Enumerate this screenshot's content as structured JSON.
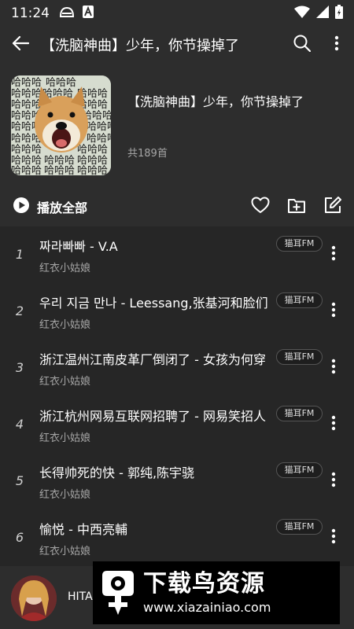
{
  "status_bar": {
    "time": "11:24",
    "left_icons": [
      "cat-ears-icon",
      "font-a-icon"
    ],
    "right_icons": [
      "wifi-icon",
      "signal-icon",
      "battery-icon"
    ]
  },
  "top_bar": {
    "title": "【洗脑神曲】少年，你节操掉了",
    "icons": [
      "back-arrow-icon",
      "search-icon",
      "more-vertical-icon"
    ]
  },
  "playlist": {
    "title": "【洗脑神曲】少年，你节操掉了",
    "count_text": "共189首",
    "cover_text": "哈哈哈"
  },
  "actions": {
    "play_all_label": "播放全部",
    "icons": [
      "play-circle-icon",
      "heart-icon",
      "add-folder-icon",
      "edit-icon"
    ]
  },
  "songs": [
    {
      "index": "1",
      "title": "짜라빠빠 - V.A",
      "artist": "红衣小姑娘",
      "badge": "猫耳FM"
    },
    {
      "index": "2",
      "title": "우리 지금 만나 - Leessang,张基河和脸们",
      "artist": "红衣小姑娘",
      "badge": "猫耳FM"
    },
    {
      "index": "3",
      "title": "浙江温州江南皮革厂倒闭了 - 女孩为何穿",
      "artist": "红衣小姑娘",
      "badge": "猫耳FM"
    },
    {
      "index": "4",
      "title": "浙江杭州网易互联网招聘了 - 网易笑招人",
      "artist": "红衣小姑娘",
      "badge": "猫耳FM"
    },
    {
      "index": "5",
      "title": "长得帅死的快 - 郭纯,陈宇骁",
      "artist": "红衣小姑娘",
      "badge": "猫耳FM"
    },
    {
      "index": "6",
      "title": "愉悦 - 中西亮輔",
      "artist": "红衣小姑娘",
      "badge": "猫耳FM"
    }
  ],
  "player": {
    "title": "HITA"
  },
  "watermark": {
    "title": "下载鸟资源",
    "url": "www.xiazainiao.com"
  },
  "colors": {
    "background": "#262626",
    "surface": "#2d2d2d",
    "secondary_text": "#a5a5a5"
  }
}
